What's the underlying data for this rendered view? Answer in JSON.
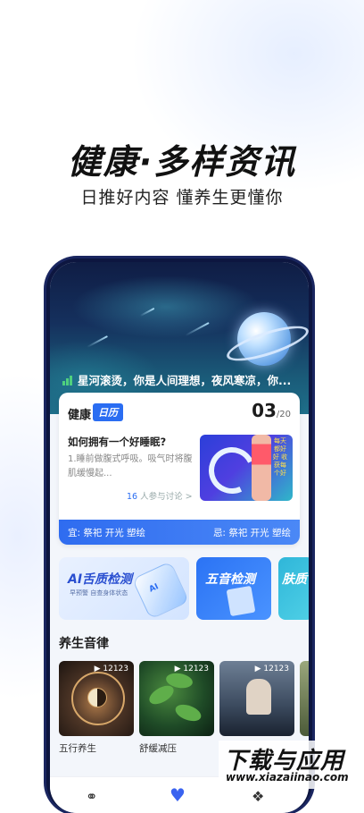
{
  "promo": {
    "title": "健康·多样资讯",
    "subtitle": "日推好内容 懂养生更懂你"
  },
  "hero": {
    "text": "星河滚烫，你是人间理想，夜风寒凉，你..."
  },
  "calendar": {
    "label": "健康",
    "badge": "日历",
    "date": "03",
    "date_suffix": "/20",
    "article_title": "如何拥有一个好睡眠?",
    "article_body": "1.睡前做腹式呼吸。吸气时将腹肌缓慢起...",
    "discuss_count": "16",
    "discuss_text": "人参与讨论 >",
    "image_tag": "每天都好好 收获每个好",
    "yi": "宜: 祭祀 开光 塑绘",
    "ji": "忌: 祭祀 开光 塑绘"
  },
  "tools": {
    "tongue_title": "AI舌质检测",
    "tongue_sub": "早预警 自查身体状态",
    "bottle_badge": "AI",
    "five_title": "五音检测",
    "skin_title": "肤质"
  },
  "music": {
    "section_title": "养生音律",
    "items": [
      {
        "label": "五行养生",
        "plays": "▶ 12123"
      },
      {
        "label": "舒缓减压",
        "plays": "▶ 12123"
      },
      {
        "label": "",
        "plays": "▶ 12123"
      }
    ]
  },
  "tabbar": {
    "icons": [
      "headphone-icon",
      "heart-icon",
      "compass-icon"
    ]
  },
  "watermark": {
    "main": "下载与应用",
    "sub": "www.xiazaiinao.com"
  },
  "colors": {
    "accent": "#2a6df2",
    "dark": "#111111"
  }
}
